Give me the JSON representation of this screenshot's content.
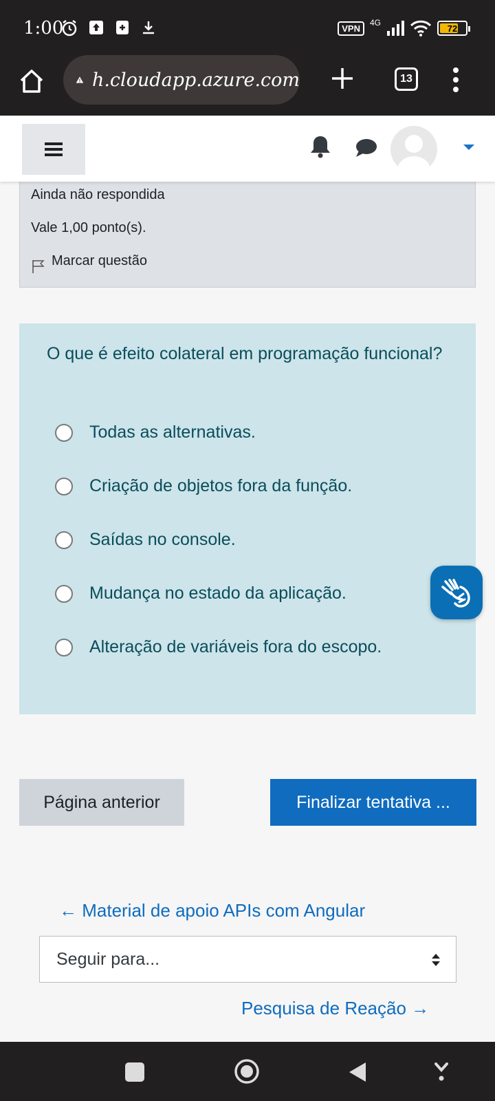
{
  "status_bar": {
    "time": "1:00",
    "vpn": "VPN",
    "network": "4G",
    "battery": "72",
    "battery_level": 0.72
  },
  "browser": {
    "url": "h.cloudapp.azure.com",
    "tab_count": "13"
  },
  "info": {
    "status": "Ainda não respondida",
    "points": "Vale 1,00 ponto(s).",
    "flag_label": "Marcar questão"
  },
  "question": {
    "text": "O que é efeito colateral em programação funcional?",
    "options": [
      "Todas as alternativas.",
      "Criação de objetos fora da função.",
      "Saídas no console.",
      "Mudança no estado da aplicação.",
      "Alteração de variáveis fora do escopo."
    ]
  },
  "buttons": {
    "previous": "Página anterior",
    "finish": "Finalizar tentativa ..."
  },
  "navigation": {
    "prev_link": "← Material de apoio APIs com Angular",
    "select_placeholder": "Seguir para...",
    "next_link": "Pesquisa de Reação →"
  },
  "colors": {
    "accent": "#0f6cbf",
    "question_bg": "#cce4ea",
    "info_bg": "#dee2e6"
  }
}
